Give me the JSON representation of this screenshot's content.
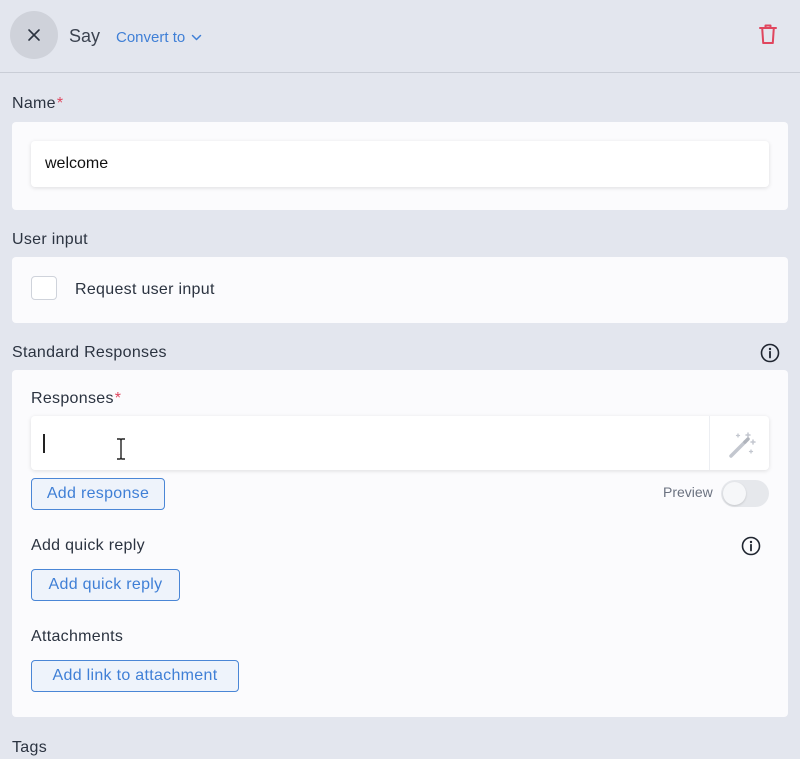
{
  "header": {
    "title": "Say",
    "convert_label": "Convert to"
  },
  "name_section": {
    "label": "Name",
    "required_mark": "*",
    "value": "welcome"
  },
  "user_input_section": {
    "label": "User input",
    "checkbox_label": "Request user input",
    "checked": false
  },
  "standard_responses": {
    "label": "Standard Responses",
    "responses_label": "Responses",
    "required_mark": "*",
    "response_value": "",
    "add_response_label": "Add response",
    "preview_label": "Preview",
    "preview_enabled": false,
    "quick_reply_label": "Add quick reply",
    "add_quick_reply_button": "Add quick reply",
    "attachments_label": "Attachments",
    "add_attachment_button": "Add link to attachment"
  },
  "tags_section": {
    "label": "Tags"
  },
  "colors": {
    "background": "#e3e6ee",
    "accent": "#3f7fd6",
    "required": "#e0465e",
    "delete": "#e0465e"
  },
  "icons": [
    "close-icon",
    "chevron-down-icon",
    "trash-icon",
    "info-icon",
    "magic-wand-icon",
    "text-cursor-icon"
  ]
}
